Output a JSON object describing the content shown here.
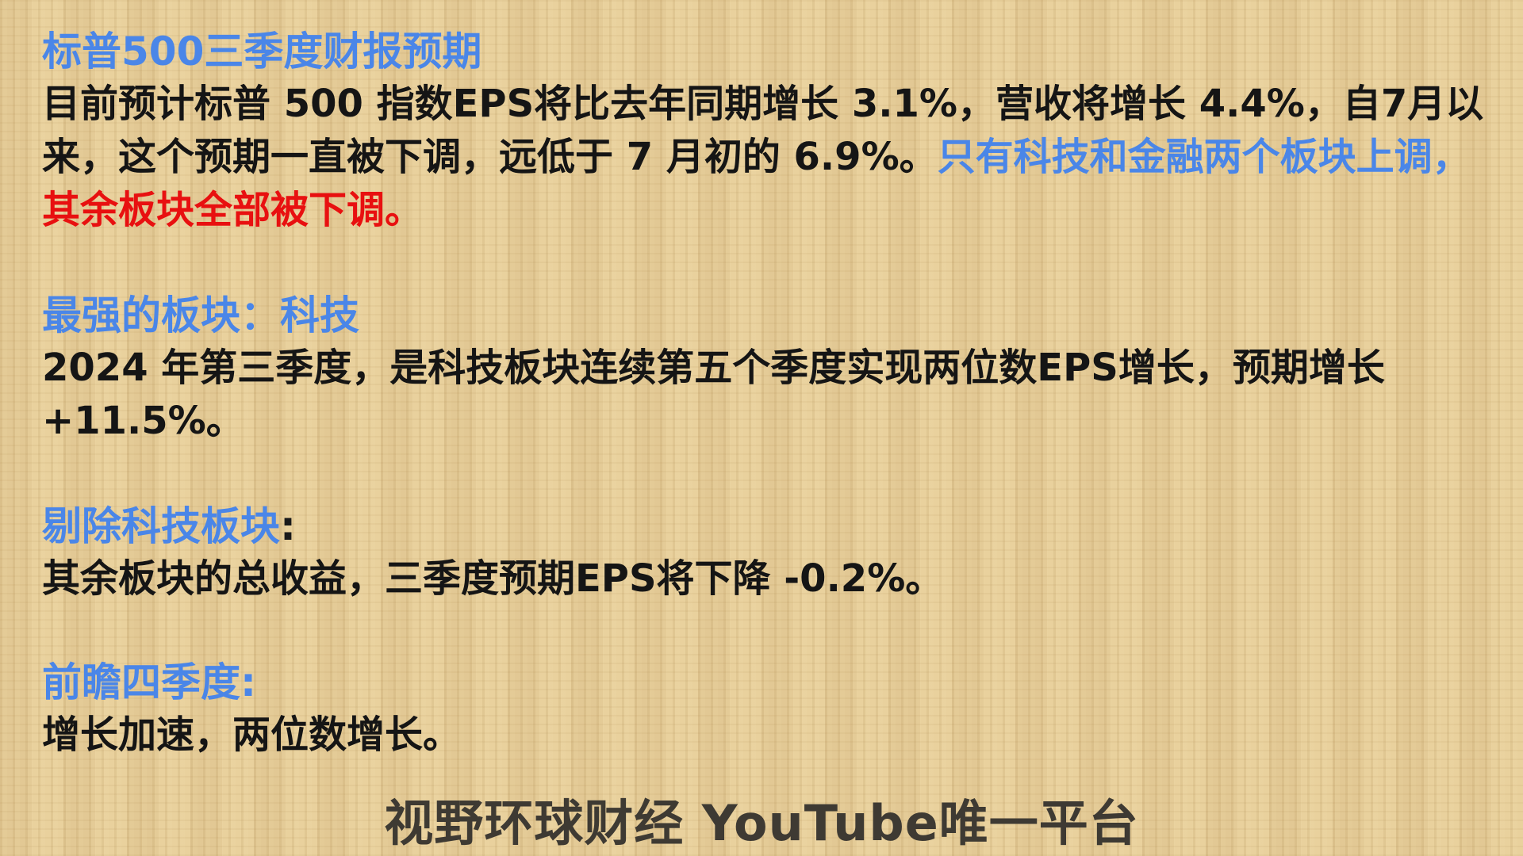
{
  "section1": {
    "heading": "标普500三季度财报预期",
    "body_part1": "目前预计标普 500 指数EPS将比去年同期增长 3.1%，营收将增长 4.4%，自7月以来，这个预期一直被下调，远低于 7 月初的 6.9%。",
    "body_part2": "只有科技和金融两个板块上调，",
    "body_part3": "其余板块全部被下调。",
    "colors": {
      "blue": "#4a86e8",
      "red": "#e81010"
    }
  },
  "section2": {
    "heading": "最强的板块：科技",
    "body": "2024 年第三季度，是科技板块连续第五个季度实现两位数EPS增长，预期增长 +11.5%。"
  },
  "section3": {
    "heading": "剔除科技板块",
    "heading_colon": ":",
    "body": "其余板块的总收益，三季度预期EPS将下降 -0.2%。"
  },
  "section4": {
    "heading": "前瞻四季度:",
    "body": "增长加速，两位数增长。"
  },
  "footer": {
    "text": "视野环球财经 YouTube唯一平台"
  }
}
